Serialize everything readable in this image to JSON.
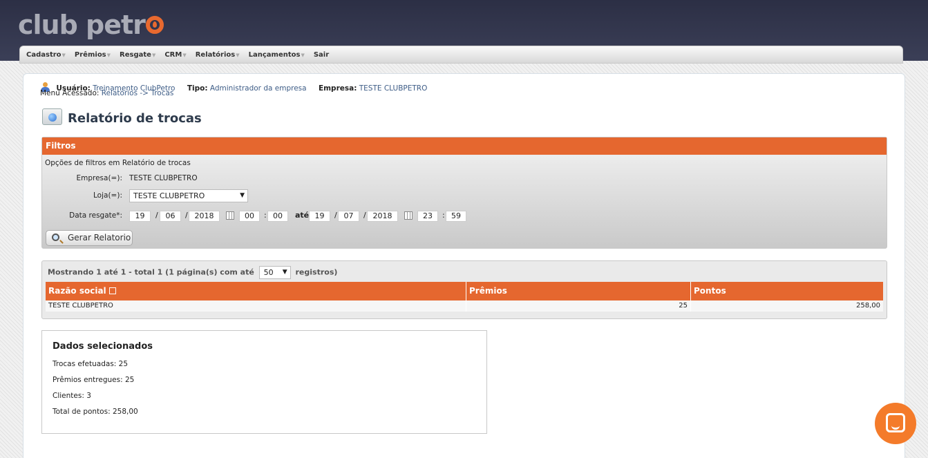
{
  "header": {
    "logo_text": "club petr"
  },
  "menu": {
    "items": [
      {
        "label": "Cadastro"
      },
      {
        "label": "Prêmios"
      },
      {
        "label": "Resgate"
      },
      {
        "label": "CRM"
      },
      {
        "label": "Relatórios"
      },
      {
        "label": "Lançamentos"
      },
      {
        "label": "Sair"
      }
    ]
  },
  "user_info": {
    "usuario_label": "Usuário:",
    "usuario_value": "Treinamento ClubPetro",
    "tipo_label": "Tipo:",
    "tipo_value": "Administrador da empresa",
    "empresa_label": "Empresa:",
    "empresa_value": "TESTE CLUBPETRO",
    "menu_label": "Menu Acessado:",
    "menu_value": "Relatórios -> Trocas"
  },
  "page": {
    "title": "Relatório de trocas"
  },
  "filters": {
    "header": "Filtros",
    "subtitle": "Opções de filtros em Relatório de trocas",
    "empresa_label": "Empresa(=):",
    "empresa_value": "TESTE CLUBPETRO",
    "loja_label": "Loja(=):",
    "loja_value": "TESTE CLUBPETRO",
    "data_label": "Data resgate*:",
    "from_day": "19",
    "from_month": "06",
    "from_year": "2018",
    "from_hour": "00",
    "from_min": "00",
    "ate_label": "até",
    "to_day": "19",
    "to_month": "07",
    "to_year": "2018",
    "to_hour": "23",
    "to_min": "59",
    "date_sep": "/",
    "time_sep": ":",
    "button_label": "Gerar Relatorio"
  },
  "results": {
    "info_prefix": "Mostrando 1 até 1 - total 1 (1 página(s) com até",
    "page_size": "50",
    "info_suffix": "registros)",
    "columns": [
      "Razão social",
      "Prêmios",
      "Pontos"
    ],
    "rows": [
      {
        "razao": "TESTE CLUBPETRO",
        "premios": "25",
        "pontos": "258,00"
      }
    ]
  },
  "dados": {
    "title": "Dados selecionados",
    "trocas": "Trocas efetuadas: 25",
    "premios": "Prêmios entregues: 25",
    "clientes": "Clientes: 3",
    "pontos": "Total de pontos: 258,00"
  },
  "colors": {
    "accent": "#e5672f",
    "header_bg": "#2c2f45",
    "link": "#3d5c86"
  }
}
